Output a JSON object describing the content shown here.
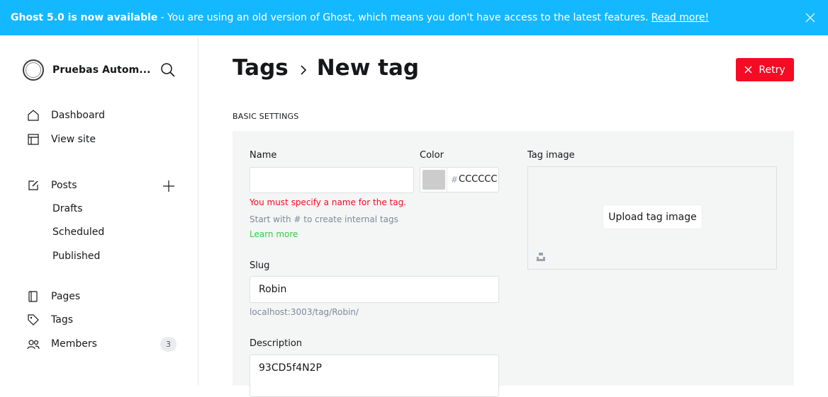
{
  "banner": {
    "title": "Ghost 5.0 is now available",
    "message": "- You are using an old version of Ghost, which means you don't have access to the latest features.",
    "link": "Read more!"
  },
  "sidebar": {
    "site_name": "Pruebas Autom...",
    "nav": {
      "dashboard": "Dashboard",
      "view_site": "View site",
      "posts": "Posts",
      "drafts": "Drafts",
      "scheduled": "Scheduled",
      "published": "Published",
      "pages": "Pages",
      "tags": "Tags",
      "members": "Members",
      "members_count": "3"
    }
  },
  "header": {
    "breadcrumb_parent": "Tags",
    "breadcrumb_current": "New tag",
    "retry_label": "Retry"
  },
  "form": {
    "section_title": "BASIC SETTINGS",
    "name_label": "Name",
    "name_value": "",
    "name_error": "You must specify a name for the tag.",
    "name_hint": "Start with # to create internal tags",
    "learn_more": "Learn more",
    "color_label": "Color",
    "color_hash": "#",
    "color_value": "CCCCCC",
    "color_swatch": "#cccccc",
    "slug_label": "Slug",
    "slug_value": "Robin",
    "slug_url": "localhost:3003/tag/Robin/",
    "description_label": "Description",
    "description_value": "93CD5f4N2P",
    "image_label": "Tag image",
    "upload_label": "Upload tag image"
  },
  "colors": {
    "banner": "#14b8ff",
    "danger": "#f50b23",
    "success": "#30cf43"
  },
  "icons": [
    "close-icon",
    "search-icon",
    "home-icon",
    "view-site-icon",
    "posts-icon",
    "plus-icon",
    "pages-icon",
    "tag-icon",
    "members-icon",
    "chevron-right-icon",
    "x-icon",
    "unsplash-icon"
  ]
}
